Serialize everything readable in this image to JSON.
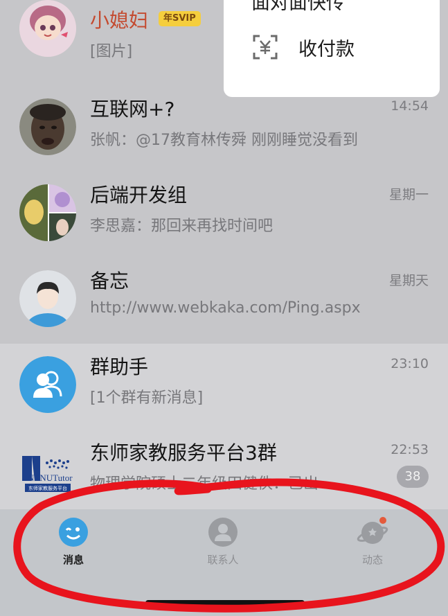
{
  "popup_menu": {
    "partial_label": "面对面快传",
    "payment_label": "收付款"
  },
  "conversations": [
    {
      "name": "小媳妇",
      "badge": "年SVIP",
      "preview": "[图片]",
      "time": "",
      "avatar_icon": "anime-girl-avatar"
    },
    {
      "name": "互联网+?",
      "preview": "张帆：@17教育林传舜 刚刚睡觉没看到",
      "time": "14:54",
      "avatar_icon": "face-photo-avatar"
    },
    {
      "name": "后端开发组",
      "preview": "李思嘉：那回来再找时间吧",
      "time": "星期一",
      "avatar_icon": "group-collage-avatar"
    },
    {
      "name": "备忘",
      "preview": "http://www.webkaka.com/Ping.aspx",
      "time": "星期天",
      "avatar_icon": "default-person-avatar"
    },
    {
      "name": "群助手",
      "preview": "[1个群有新消息]",
      "time": "23:10",
      "avatar_icon": "group-assistant-icon"
    },
    {
      "name": "东师家教服务平台3群",
      "preview": "物理学院硕士二年级田健佚：已出",
      "time": "22:53",
      "unread": "38",
      "avatar_icon": "nenu-tutor-logo"
    }
  ],
  "logo_text": {
    "brand": "NENUTutor",
    "subtitle": "东师家教服务平台"
  },
  "tabbar": {
    "tabs": [
      {
        "label": "消息",
        "active": true,
        "icon": "message-icon"
      },
      {
        "label": "联系人",
        "active": false,
        "icon": "contacts-icon"
      },
      {
        "label": "动态",
        "active": false,
        "icon": "planet-icon",
        "has_dot": true
      }
    ]
  },
  "colors": {
    "vip_name": "#c44a2f",
    "active_tab": "#1d1d1d",
    "accent_blue": "#3aa0e0",
    "notification_dot": "#e45a3b",
    "annotation_red": "#e8141d"
  }
}
